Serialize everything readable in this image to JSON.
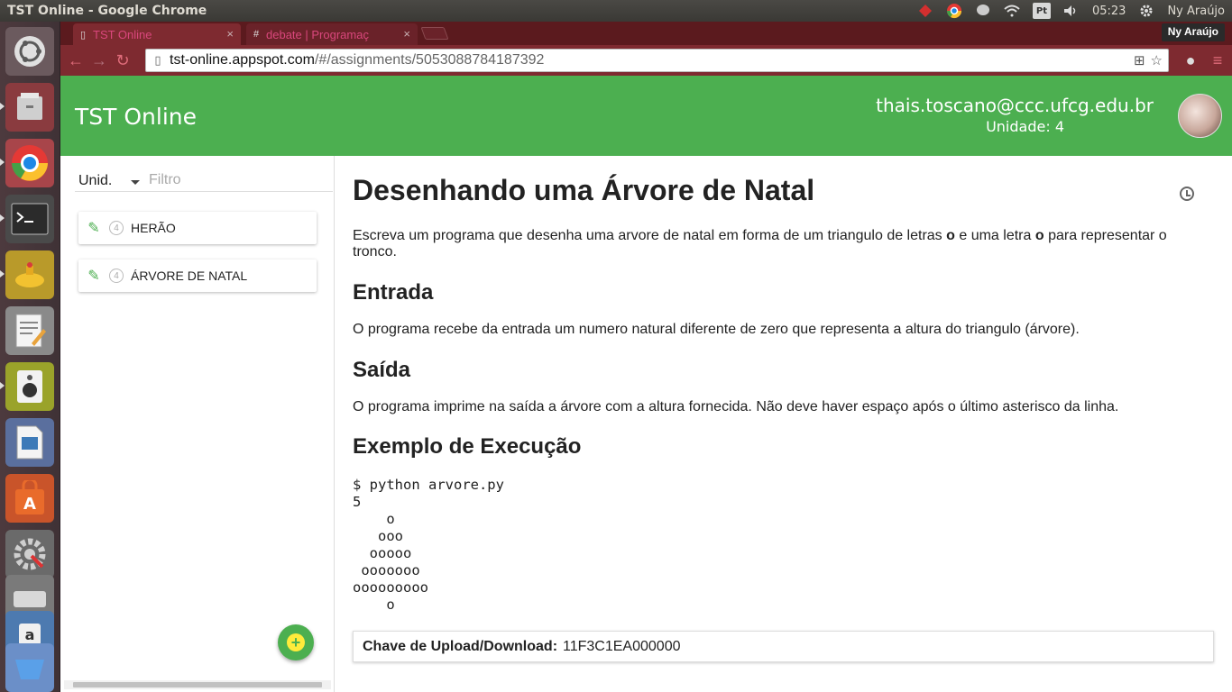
{
  "panel": {
    "window_title": "TST Online - Google Chrome",
    "time": "05:23",
    "user_name": "Ny Araújo",
    "keyboard_layout": "Pt"
  },
  "browser": {
    "tabs": [
      {
        "title": "TST Online",
        "active": true,
        "icon": "page-icon"
      },
      {
        "title": "debate | Programaç",
        "active": false,
        "icon": "hash-icon"
      }
    ],
    "profile_name": "Ny Araújo",
    "url_host": "tst-online.appspot.com",
    "url_path": "/#/assignments/5053088784187392"
  },
  "app": {
    "title": "TST Online",
    "user_email": "thais.toscano@ccc.ufcg.edu.br",
    "user_unit": "Unidade: 4",
    "accent_color": "#4caf50"
  },
  "sidebar": {
    "unit_select": "Unid.",
    "filter_placeholder": "Filtro",
    "items": [
      {
        "count": "4",
        "label": "HERÃO"
      },
      {
        "count": "4",
        "label": "ÁRVORE DE NATAL"
      }
    ],
    "add_icon": "plus-icon"
  },
  "problem": {
    "title": "Desenhando uma Árvore de Natal",
    "intro_part1": "Escreva um programa que desenha uma arvore de natal em forma de um triangulo de letras ",
    "intro_bold1": "o",
    "intro_part2": " e uma letra ",
    "intro_bold2": "o",
    "intro_part3": " para representar o tronco.",
    "input_heading": "Entrada",
    "input_text": "O programa recebe da entrada um numero natural diferente de zero que representa a altura do triangulo (árvore).",
    "output_heading": "Saída",
    "output_text": "O programa imprime na saída a árvore com a altura fornecida. Não deve haver espaço após o último asterisco da linha.",
    "example_heading": "Exemplo de Execução",
    "example_lines": "$ python arvore.py\n5\n    o\n   ooo\n  ooooo\n ooooooo\nooooooooo\n    o",
    "upload_label": "Chave de Upload/Download:",
    "upload_value": "11F3C1EA000000"
  }
}
